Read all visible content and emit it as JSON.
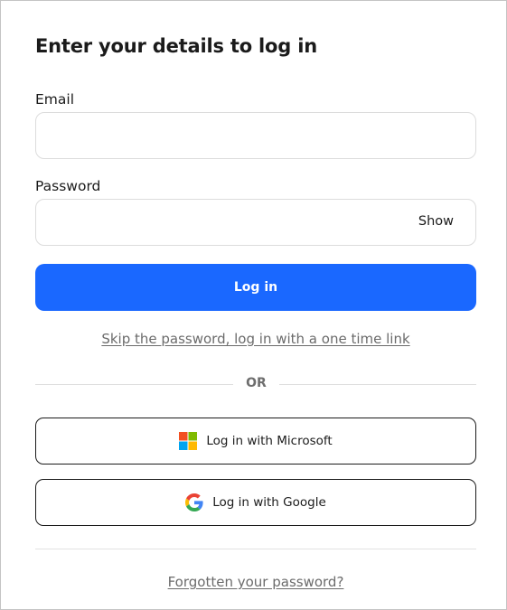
{
  "form": {
    "title": "Enter your details to log in",
    "email": {
      "label": "Email",
      "value": "",
      "placeholder": ""
    },
    "password": {
      "label": "Password",
      "value": "",
      "placeholder": "",
      "toggle_label": "Show"
    },
    "login_button_label": "Log in",
    "skip_password_link": "Skip the password, log in with a one time link",
    "divider_text": "OR",
    "sso": [
      {
        "label": "Log in with Microsoft",
        "icon": "microsoft-logo-icon"
      },
      {
        "label": "Log in with Google",
        "icon": "google-logo-icon"
      }
    ],
    "forgot_password_link": "Forgotten your password?"
  },
  "colors": {
    "primary": "#1a68ff",
    "text": "#1b1b1b",
    "muted": "#6b6b6b",
    "border": "#dcdcdc"
  }
}
